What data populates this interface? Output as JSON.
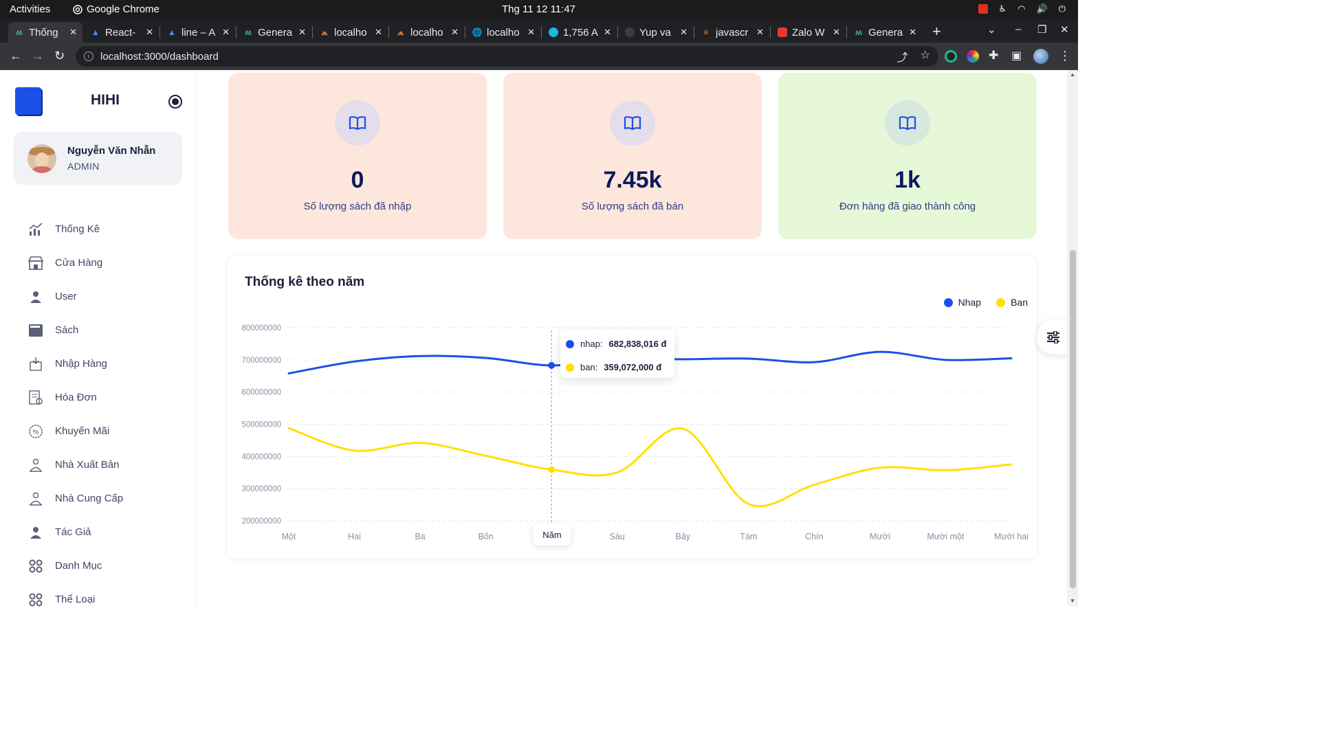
{
  "os_bar": {
    "activities": "Activities",
    "app_name": "Google Chrome",
    "clock": "Thg 11 12  11:47"
  },
  "browser": {
    "tabs": [
      {
        "title": "Thống",
        "favicon": "vue-icon",
        "active": true
      },
      {
        "title": "React-",
        "favicon": "mui-icon"
      },
      {
        "title": "line – A",
        "favicon": "mui-icon"
      },
      {
        "title": "Genera",
        "favicon": "vue-icon"
      },
      {
        "title": "localho",
        "favicon": "matlab-icon"
      },
      {
        "title": "localho",
        "favicon": "matlab-icon"
      },
      {
        "title": "localho",
        "favicon": "globe-icon"
      },
      {
        "title": "1,756 A",
        "favicon": "search-icon"
      },
      {
        "title": "Yup va",
        "favicon": "github-icon"
      },
      {
        "title": "javascr",
        "favicon": "stackoverflow-icon"
      },
      {
        "title": "Zalo W",
        "favicon": "zalo-icon"
      },
      {
        "title": "Genera",
        "favicon": "vue-icon"
      }
    ],
    "url": "localhost:3000/dashboard"
  },
  "sidebar": {
    "brand": "HIHI",
    "user": {
      "name": "Nguyễn Văn Nhẫn",
      "role": "ADMIN"
    },
    "items": [
      {
        "label": "Thống Kê",
        "icon": "chart-icon"
      },
      {
        "label": "Cửa Hàng",
        "icon": "store-icon"
      },
      {
        "label": "User",
        "icon": "user-icon"
      },
      {
        "label": "Sách",
        "icon": "book-icon"
      },
      {
        "label": "Nhập Hàng",
        "icon": "import-icon"
      },
      {
        "label": "Hóa Đơn",
        "icon": "invoice-icon"
      },
      {
        "label": "Khuyến Mãi",
        "icon": "discount-icon"
      },
      {
        "label": "Nhà Xuất Bản",
        "icon": "publisher-icon"
      },
      {
        "label": "Nhà Cung Cấp",
        "icon": "supplier-icon"
      },
      {
        "label": "Tác Giả",
        "icon": "author-icon"
      },
      {
        "label": "Danh Mục",
        "icon": "grid-icon"
      },
      {
        "label": "Thể Loại",
        "icon": "grid-icon"
      }
    ]
  },
  "cards": [
    {
      "value": "0",
      "label": "Số lượng sách đã nhập",
      "bg": "#fde7dc",
      "icon_bg": "#e4ddea"
    },
    {
      "value": "7.45k",
      "label": "Số lượng sách đã bán",
      "bg": "#fde7dc",
      "icon_bg": "#e4ddea"
    },
    {
      "value": "1k",
      "label": "Đơn hàng đã giao thành công",
      "bg": "#e6f8d8",
      "icon_bg": "#d8e8df"
    }
  ],
  "chart": {
    "title": "Thống kê theo năm",
    "tooltip": {
      "nhap_label": "nhap:",
      "nhap_value": "682,838,016 đ",
      "ban_label": "ban:",
      "ban_value": "359,072,000 đ"
    },
    "hover_category": "Năm"
  },
  "chart_data": {
    "type": "line",
    "categories": [
      "Một",
      "Hai",
      "Ba",
      "Bốn",
      "Năm",
      "Sáu",
      "Bảy",
      "Tám",
      "Chín",
      "Mười",
      "Mười một",
      "Mười hai"
    ],
    "series": [
      {
        "name": "Nhap",
        "color": "#1a4fe8",
        "values": [
          658000000,
          695000000,
          712000000,
          706000000,
          682838016,
          702000000,
          702000000,
          704000000,
          693000000,
          725000000,
          700000000,
          705000000
        ]
      },
      {
        "name": "Ban",
        "color": "#ffe000",
        "values": [
          488000000,
          418000000,
          442000000,
          402000000,
          359072000,
          350000000,
          486000000,
          252000000,
          312000000,
          365000000,
          357000000,
          375000000
        ]
      }
    ],
    "ylim": [
      200000000,
      800000000
    ],
    "yticks": [
      "800000000",
      "700000000",
      "600000000",
      "500000000",
      "400000000",
      "300000000",
      "200000000"
    ],
    "grid": true,
    "legend_position": "top-right"
  }
}
